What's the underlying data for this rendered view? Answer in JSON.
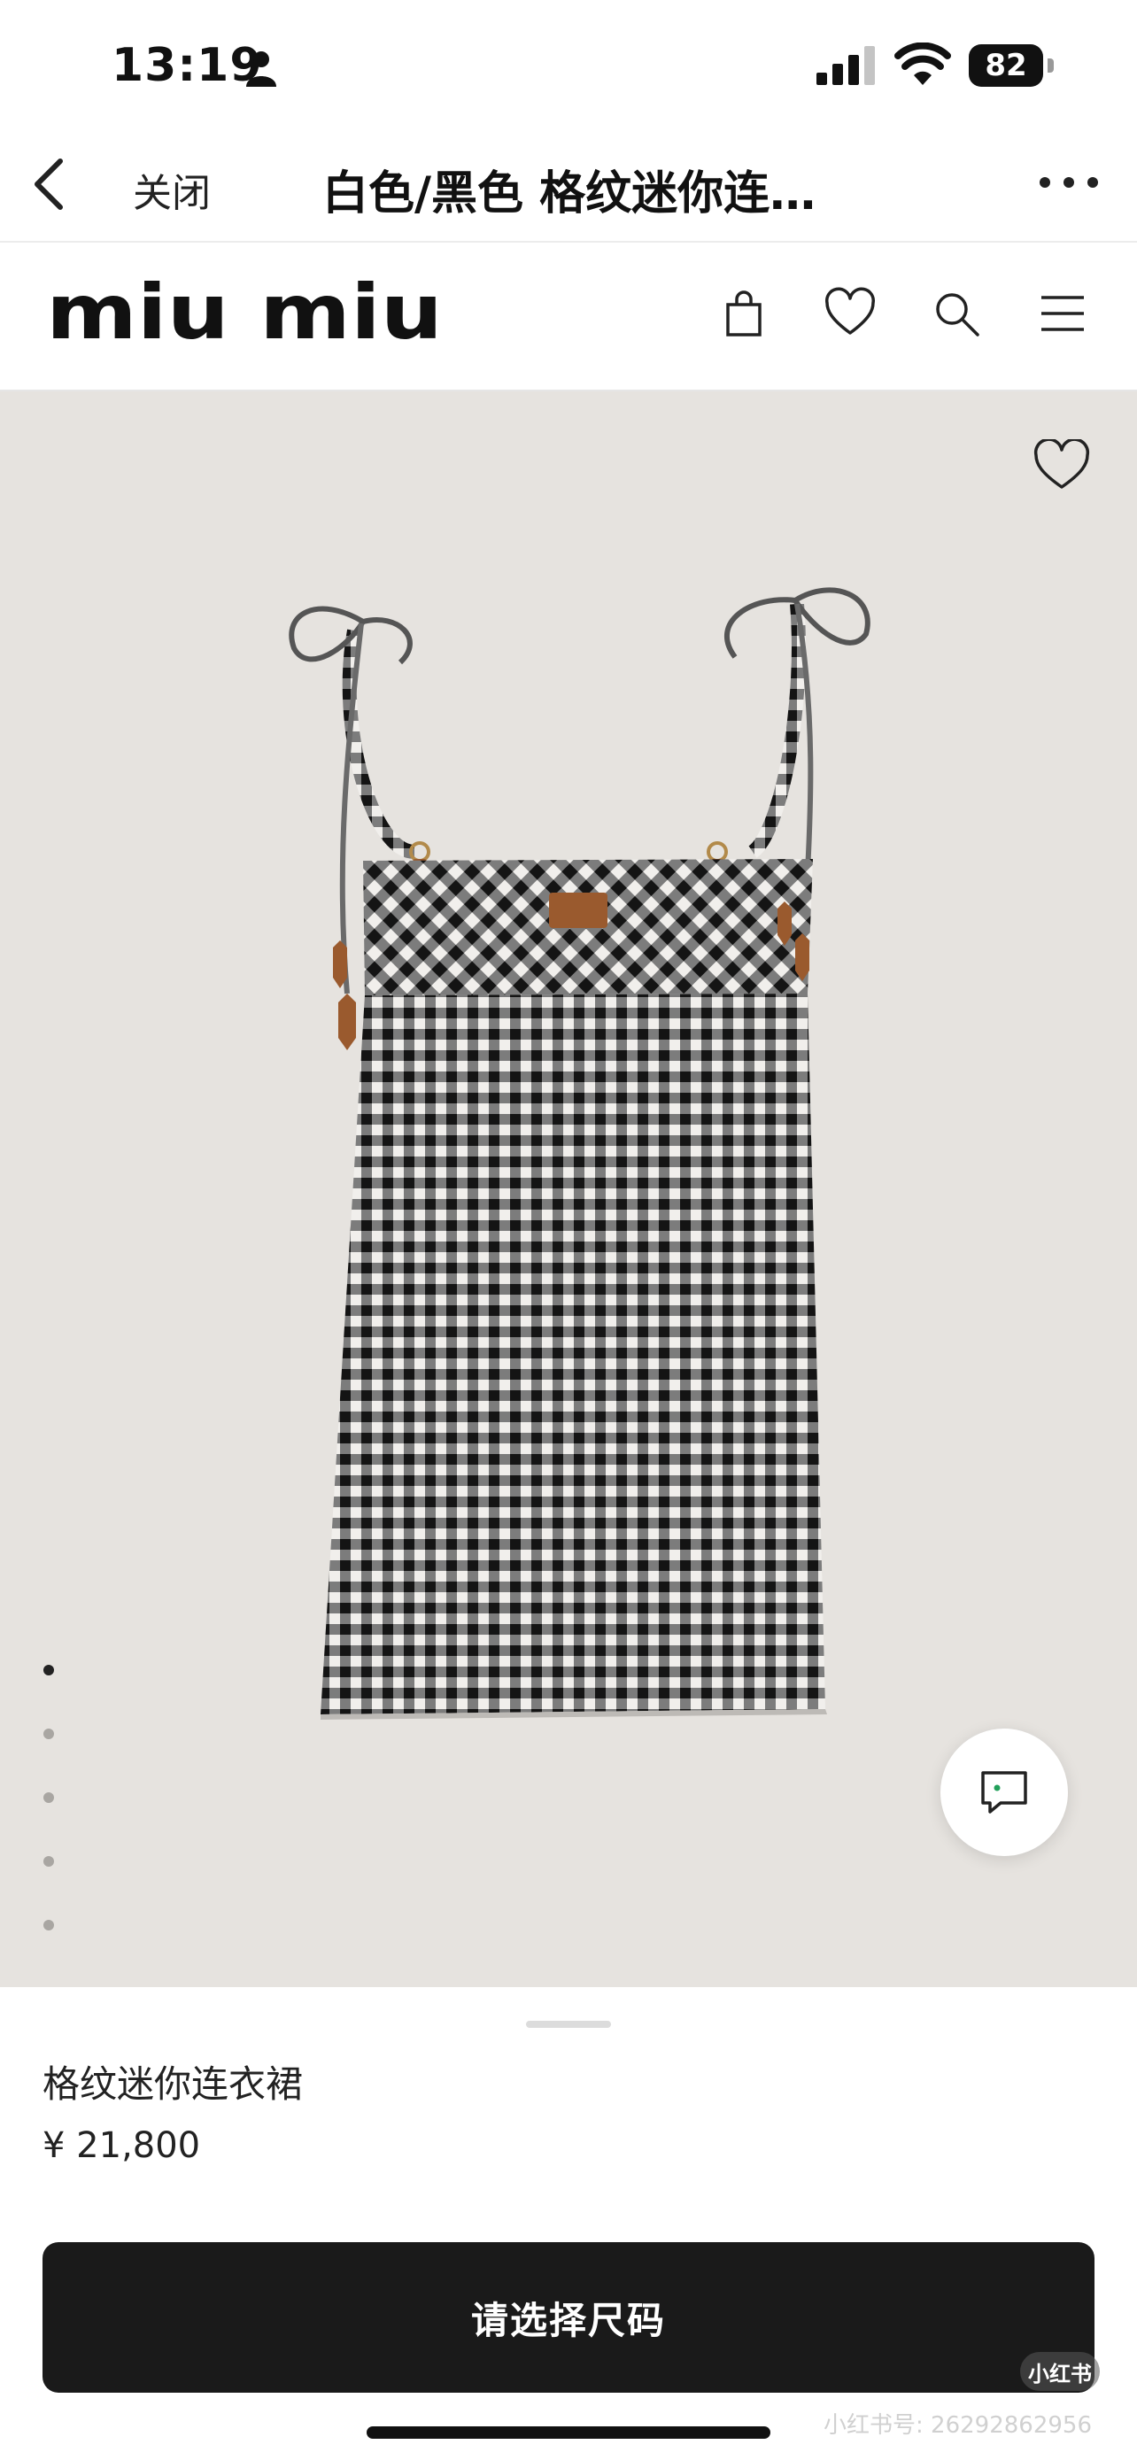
{
  "status_bar": {
    "time": "13:19",
    "battery": "82"
  },
  "browser_nav": {
    "close_label": "关闭",
    "title": "白色/黑色 格纹迷你连…"
  },
  "site_header": {
    "logo_text": "miu miu",
    "icons": [
      "shopping-bag-icon",
      "heart-icon",
      "search-icon",
      "menu-icon"
    ]
  },
  "gallery": {
    "image_count": 5,
    "active_index": 0
  },
  "product": {
    "name": "格纹迷你连衣裙",
    "price": "¥ 21,800",
    "cta_label": "请选择尺码"
  },
  "watermark": {
    "badge": "小红书",
    "text": "小红书号: 26292862956"
  },
  "colors": {
    "image_background": "#e6e3df",
    "cta_background": "#1a1a1a",
    "leather_accent": "#9a5a2e"
  }
}
